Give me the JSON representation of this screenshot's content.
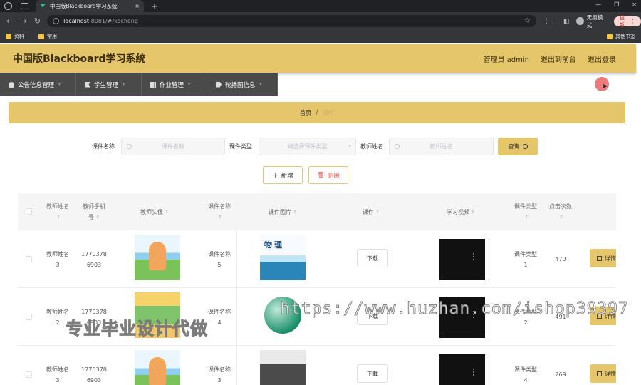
{
  "browser": {
    "tab_title": "中国版Blackboard学习系统",
    "tab_close": "×",
    "new_tab": "+",
    "url_host": "localhost",
    "url_path": ":8081/#/kecheng",
    "incognito_label": "无痕模式",
    "update_label": "更新",
    "bookmarks": [
      "资料",
      "常用"
    ],
    "other_bookmarks": "其他书签",
    "window_controls": [
      "—",
      "❐",
      "✕"
    ]
  },
  "header": {
    "title": "中国版Blackboard学习系统",
    "admin": "管理员 admin",
    "to_front": "退出到前台",
    "logout": "退出登录"
  },
  "menu": [
    {
      "label": "公告信息管理",
      "icon": "user-icon"
    },
    {
      "label": "学生管理",
      "icon": "flag-icon"
    },
    {
      "label": "作业管理",
      "icon": "chart-icon"
    },
    {
      "label": "轮播图信息",
      "icon": "tag-icon"
    }
  ],
  "breadcrumb": {
    "home": "首页",
    "separator": "/",
    "current": "课件"
  },
  "search": {
    "name_label": "课件名称",
    "name_placeholder": "课件名称",
    "type_label": "课件类型",
    "type_placeholder": "请选择课件类型",
    "teacher_label": "教师姓名",
    "teacher_placeholder": "教师姓名",
    "query_label": "查询"
  },
  "actions": {
    "add_label": "新增",
    "delete_label": "删除"
  },
  "table": {
    "headers": {
      "teacher_name": "教师姓名",
      "teacher_phone_1": "教师手机",
      "teacher_phone_2": "号",
      "avatar": "教师头像",
      "courseware_name": "课件名称",
      "courseware_image": "课件图片",
      "courseware": "课件",
      "video": "学习视频",
      "courseware_type": "课件类型",
      "clicks": "点击次数"
    },
    "download_label": "下载",
    "detail_label": "详情",
    "rows": [
      {
        "teacher_name_1": "教师姓名",
        "teacher_name_2": "3",
        "phone_1": "1770378",
        "phone_2": "6903",
        "course_1": "课件名称",
        "course_2": "5",
        "type_1": "课件类型",
        "type_2": "1",
        "clicks": "470",
        "image_text": "物理"
      },
      {
        "teacher_name_1": "教师姓名",
        "teacher_name_2": "2",
        "phone_1": "1770378",
        "phone_2": "6903",
        "course_1": "课件名称",
        "course_2": "4",
        "type_1": "课件类型",
        "type_2": "2",
        "clicks": "491"
      },
      {
        "teacher_name_1": "教师姓名",
        "teacher_name_2": "3",
        "phone_1": "1770378",
        "phone_2": "6903",
        "course_1": "课件名称",
        "course_2": "3",
        "type_1": "课件类型",
        "type_2": "4",
        "clicks": "269"
      }
    ]
  },
  "watermarks": {
    "url": "https://www.huzhan.com/ishop39397",
    "text": "专业毕业设计代做"
  },
  "colors": {
    "accent": "#e6c66a",
    "menu_bg": "#4a4a4a"
  }
}
